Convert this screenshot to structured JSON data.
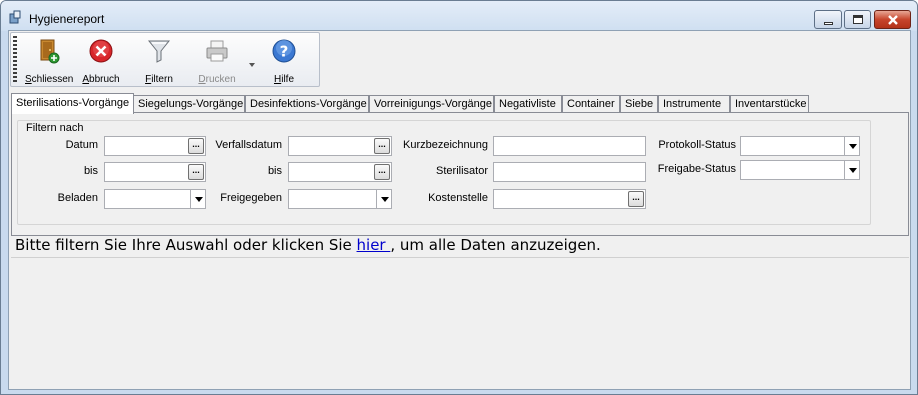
{
  "window": {
    "title": "Hygienereport",
    "controls": {
      "minimize": "minimize",
      "maximize": "maximize",
      "close": "close"
    }
  },
  "toolbar": {
    "buttons": [
      {
        "label": "Schliessen",
        "icon": "exit-door-icon",
        "enabled": true
      },
      {
        "label": "Abbruch",
        "icon": "cancel-x-icon",
        "enabled": true
      },
      {
        "label": "Filtern",
        "icon": "funnel-filter-icon",
        "enabled": true
      },
      {
        "label": "Drucken",
        "icon": "printer-icon",
        "enabled": false
      },
      {
        "label": "Hilfe",
        "icon": "help-question-icon",
        "enabled": true
      }
    ]
  },
  "tabs": [
    {
      "label": "Sterilisations-Vorgänge",
      "active": true
    },
    {
      "label": "Siegelungs-Vorgänge"
    },
    {
      "label": "Desinfektions-Vorgänge"
    },
    {
      "label": "Vorreinigungs-Vorgänge"
    },
    {
      "label": "Negativliste"
    },
    {
      "label": "Container"
    },
    {
      "label": "Siebe"
    },
    {
      "label": "Instrumente"
    },
    {
      "label": "Inventarstücke"
    }
  ],
  "filter": {
    "legend": "Filtern nach",
    "datum": {
      "label": "Datum",
      "value": ""
    },
    "datum_bis": {
      "label": "bis",
      "value": ""
    },
    "beladen": {
      "label": "Beladen",
      "value": ""
    },
    "verfallsdatum": {
      "label": "Verfallsdatum",
      "value": ""
    },
    "verfallsdatum_bis": {
      "label": "bis",
      "value": ""
    },
    "freigegeben": {
      "label": "Freigegeben",
      "value": ""
    },
    "kurzbezeichnung": {
      "label": "Kurzbezeichnung",
      "value": ""
    },
    "sterilisator": {
      "label": "Sterilisator",
      "value": ""
    },
    "kostenstelle": {
      "label": "Kostenstelle",
      "value": ""
    },
    "protokoll_status": {
      "label": "Protokoll-Status",
      "value": ""
    },
    "freigabe_status": {
      "label": "Freigabe-Status",
      "value": ""
    },
    "ellipsis": "..."
  },
  "info": {
    "before": "Bitte filtern Sie Ihre Auswahl oder klicken Sie ",
    "link": " hier ",
    "after": ", um alle Daten anzuzeigen."
  },
  "colors": {
    "link": "#0000cc",
    "window_frame": "#c9daee",
    "close_button": "#c7452c"
  }
}
